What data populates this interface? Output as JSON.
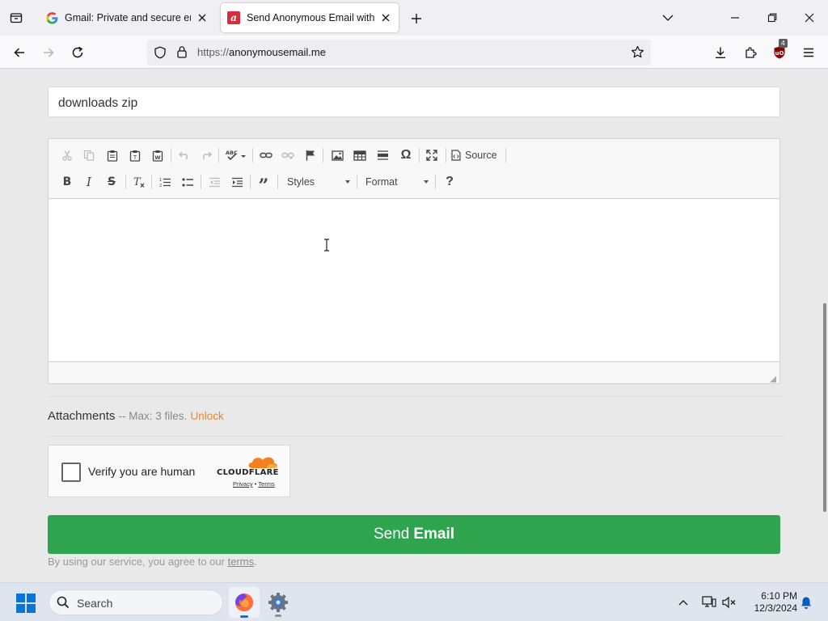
{
  "browser": {
    "tabs": [
      {
        "title": "Gmail: Private and secure email at no cost | Google Workspace",
        "active": false,
        "favicon": "google-g-icon"
      },
      {
        "title": "Send Anonymous Email with the Best Anonymous Email Service",
        "active": true,
        "favicon": "anonymousemail-logo-icon"
      }
    ],
    "url_prefix": "https://",
    "url_host": "anonymousemail.me",
    "extension_badge": "4"
  },
  "form": {
    "subject_value": "downloads zip",
    "toolbar": {
      "source_label": "Source",
      "styles_label": "Styles",
      "format_label": "Format",
      "help_label": "?"
    },
    "attachments": {
      "label": "Attachments",
      "note": "-- Max: 3 files.",
      "unlock": "Unlock"
    },
    "captcha": {
      "label": "Verify you are human",
      "brand": "CLOUDFLARE",
      "privacy": "Privacy",
      "sep": "•",
      "terms": "Terms"
    },
    "send_prefix": "Send",
    "send_bold": "Email",
    "tos_text": "By using our service, you agree to our",
    "tos_link": "terms",
    "tos_end": "."
  },
  "taskbar": {
    "search_label": "Search",
    "time": "6:10 PM",
    "date": "12/3/2024"
  },
  "colors": {
    "send_button": "#2ea44f",
    "unlock_link": "#e58a2e",
    "cloudflare_orange": "#f48120"
  }
}
